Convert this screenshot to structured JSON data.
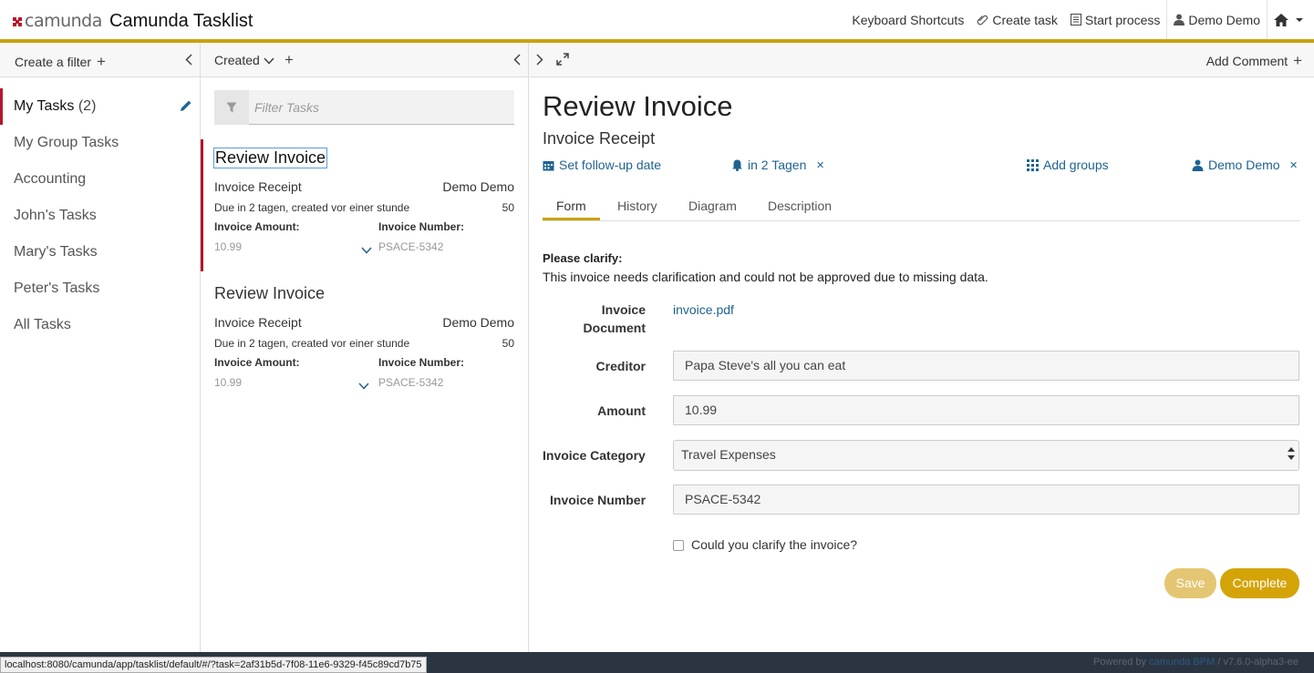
{
  "header": {
    "logo_text": "camunda",
    "app_title": "Camunda Tasklist",
    "nav": {
      "keyboard_shortcuts": "Keyboard Shortcuts",
      "create_task": "Create task",
      "start_process": "Start process",
      "user": "Demo Demo"
    }
  },
  "colors": {
    "accent": "#c9a20d",
    "selected_border": "#b5152b",
    "link": "#1f6391",
    "footer_bg": "#2b3542"
  },
  "filters": {
    "header_label": "Create a filter",
    "items": [
      {
        "label": "My Tasks",
        "count": "(2)"
      },
      {
        "label": "My Group Tasks"
      },
      {
        "label": "Accounting"
      },
      {
        "label": "John's Tasks"
      },
      {
        "label": "Mary's Tasks"
      },
      {
        "label": "Peter's Tasks"
      },
      {
        "label": "All Tasks"
      }
    ]
  },
  "tasklist": {
    "sort_label": "Created",
    "search_placeholder": "Filter Tasks",
    "tasks": [
      {
        "name": "Review Invoice",
        "process": "Invoice Receipt",
        "assignee": "Demo Demo",
        "due": "Due in 2 tagen, created vor einer stunde",
        "priority": "50",
        "var1_label": "Invoice Amount:",
        "var1_value": "10.99",
        "var2_label": "Invoice Number:",
        "var2_value": "PSACE-5342"
      },
      {
        "name": "Review Invoice",
        "process": "Invoice Receipt",
        "assignee": "Demo Demo",
        "due": "Due in 2 tagen, created vor einer stunde",
        "priority": "50",
        "var1_label": "Invoice Amount:",
        "var1_value": "10.99",
        "var2_label": "Invoice Number:",
        "var2_value": "PSACE-5342"
      }
    ]
  },
  "detail": {
    "add_comment": "Add Comment",
    "title": "Review Invoice",
    "process_name": "Invoice Receipt",
    "follow_up": "Set follow-up date",
    "due": "in 2 Tagen",
    "groups": "Add groups",
    "assignee": "Demo Demo",
    "tabs": [
      "Form",
      "History",
      "Diagram",
      "Description"
    ],
    "form": {
      "title": "Please clarify:",
      "description": "This invoice needs clarification and could not be approved due to missing data.",
      "document_label_1": "Invoice",
      "document_label_2": "Document",
      "document_link": "invoice.pdf",
      "creditor_label": "Creditor",
      "creditor_value": "Papa Steve's all you can eat",
      "amount_label": "Amount",
      "amount_value": "10.99",
      "category_label": "Invoice Category",
      "category_value": "Travel Expenses",
      "number_label": "Invoice Number",
      "number_value": "PSACE-5342",
      "checkbox_label": "Could you clarify the invoice?",
      "save": "Save",
      "complete": "Complete"
    }
  },
  "footer": {
    "powered_by": "Powered by",
    "product": "camunda BPM",
    "version": "/ v7.6.0-alpha3-ee"
  },
  "statusbar": {
    "url": "localhost:8080/camunda/app/tasklist/default/#/?task=2af31b5d-7f08-11e6-9329-f45c89cd7b75"
  }
}
